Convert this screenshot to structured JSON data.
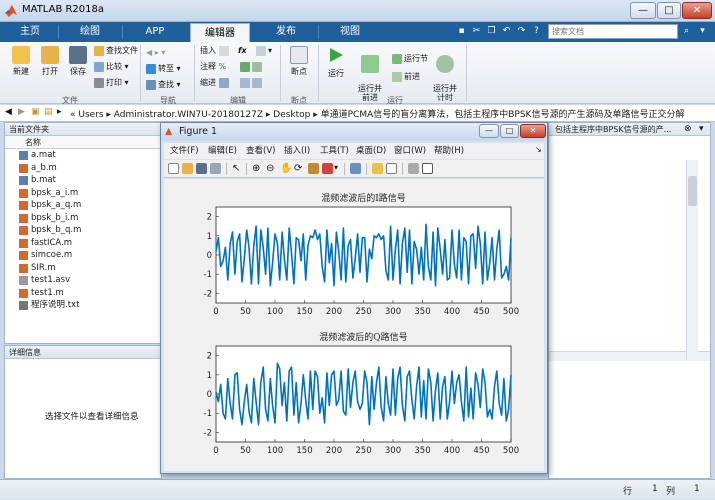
{
  "window": {
    "title": "MATLAB R2018a",
    "min": "—",
    "max": "□",
    "close": "✕"
  },
  "tabs": [
    "主页",
    "绘图",
    "APP",
    "编辑器",
    "发布",
    "视图"
  ],
  "search": {
    "placeholder": "搜索文档"
  },
  "toolstrip": {
    "file": {
      "new": "新建",
      "open": "打开",
      "save": "保存",
      "find_files": "查找文件",
      "compare": "比较",
      "print": "打印",
      "label": "文件"
    },
    "nav": {
      "goto": "转至",
      "find": "查找",
      "label": "导航"
    },
    "edit": {
      "insert": "插入",
      "comment": "注释",
      "indent": "缩进",
      "fx": "fx",
      "label": "编辑"
    },
    "breakpoint": {
      "bp": "断点",
      "label": "断点"
    },
    "run": {
      "run": "运行",
      "run_advance": "运行并\n前进",
      "run_section": "运行节",
      "advance": "前进",
      "run_time": "运行并\n计时",
      "label": "运行"
    }
  },
  "address": {
    "path": "« Users ▸ Administrator.WIN7U-20180127Z ▸ Desktop ▸ 单通道PCMA信号的盲分离算法，包括主程序中BPSK信号源的产生源码及单路信号正交分解"
  },
  "current_folder": {
    "title": "当前文件夹",
    "column": "名称",
    "files": [
      "a.mat",
      "a_b.m",
      "b.mat",
      "bpsk_a_i.m",
      "bpsk_a_q.m",
      "bpsk_b_i.m",
      "bpsk_b_q.m",
      "fastICA.m",
      "simcoe.m",
      "SIR.m",
      "test1.asv",
      "test1.m",
      "程序说明.txt"
    ]
  },
  "details": {
    "title": "详细信息",
    "message": "选择文件以查看详细信息"
  },
  "right_panel": {
    "title": "包括主程序中BPSK信号源的产..."
  },
  "status": {
    "row_label": "行",
    "row_value": "1",
    "col_label": "列",
    "col_value": "1"
  },
  "figure": {
    "title": "Figure 1",
    "menus": [
      "文件(F)",
      "编辑(E)",
      "查看(V)",
      "插入(I)",
      "工具(T)",
      "桌面(D)",
      "窗口(W)",
      "帮助(H)"
    ]
  },
  "chart_data": [
    {
      "type": "line",
      "title": "混频滤波后的I路信号",
      "xlim": [
        0,
        500
      ],
      "ylim": [
        -2.5,
        2.5
      ],
      "xticks": [
        0,
        50,
        100,
        150,
        200,
        250,
        300,
        350,
        400,
        450,
        500
      ],
      "yticks": [
        2,
        1,
        0,
        -1,
        -2
      ],
      "grid": false,
      "color": "#0072bd",
      "series": [
        {
          "x_step": 4,
          "values": [
            0.2,
            0.9,
            -0.6,
            -0.3,
            0.4,
            -1.3,
            0.6,
            1.2,
            -1.0,
            0.7,
            1.1,
            -1.4,
            -0.2,
            1.3,
            0.4,
            -1.5,
            0.5,
            1.5,
            -1.5,
            1.3,
            0.4,
            -1.0,
            1.4,
            -1.6,
            -0.4,
            1.1,
            0.6,
            -1.3,
            1.2,
            -0.2,
            -1.3,
            1.4,
            0.1,
            -1.5,
            0.9,
            0.8,
            -0.3,
            1.1,
            -1.3,
            0.5,
            1.0,
            0.9,
            1.3,
            0.8,
            1.1,
            -0.6,
            -1.4,
            1.3,
            -0.4,
            0.6,
            -1.6,
            1.2,
            0.2,
            -1.3,
            1.4,
            -1.4,
            0.5,
            0.8,
            -1.2,
            -0.2,
            1.1,
            -0.9,
            0.9,
            0.9,
            -1.4,
            0.3,
            -0.2,
            1.0,
            0.9,
            1.1,
            0.8,
            1.0,
            -0.8,
            -1.3,
            1.5,
            -1.3,
            0.3,
            1.3,
            -1.5,
            0.6,
            1.4,
            -0.9,
            1.3,
            -1.5,
            0.7,
            0.3,
            -1.0,
            0.4,
            -1.3,
            1.6,
            -0.6,
            -1.3,
            1.2,
            -1.6,
            1.4,
            0.3,
            -1.0,
            0.8,
            -1.3,
            -1.2,
            1.3,
            -0.5,
            -1.2,
            1.3,
            -1.3,
            0.9,
            0.7,
            -1.5,
            1.0,
            1.1,
            -0.7,
            1.5,
            0.6,
            -1.5,
            1.2,
            -1.3,
            -0.4,
            0.9,
            -1.3,
            0.3,
            1.3,
            -1.2,
            -1.0,
            -0.6,
            -1.3,
            0.9
          ]
        }
      ]
    },
    {
      "type": "line",
      "title": "混频滤波后的Q路信号",
      "xlim": [
        0,
        500
      ],
      "ylim": [
        -2.5,
        2.5
      ],
      "xticks": [
        0,
        50,
        100,
        150,
        200,
        250,
        300,
        350,
        400,
        450,
        500
      ],
      "yticks": [
        2,
        1,
        0,
        -1,
        -2
      ],
      "grid": false,
      "color": "#0072bd",
      "series": [
        {
          "x_step": 4,
          "values": [
            0.1,
            -0.4,
            0.5,
            -1.0,
            -1.3,
            0.8,
            -0.5,
            -1.3,
            1.0,
            1.1,
            -0.8,
            -1.6,
            -0.4,
            0.5,
            -0.9,
            -1.5,
            0.8,
            -0.4,
            -1.6,
            0.6,
            1.4,
            -0.8,
            -1.4,
            0.8,
            -0.6,
            -1.5,
            1.6,
            1.3,
            -0.6,
            0.6,
            -1.4,
            1.2,
            1.4,
            -1.1,
            0.6,
            -1.5,
            -0.5,
            1.0,
            -0.3,
            -1.3,
            1.2,
            -0.8,
            1.2,
            0.9,
            -1.0,
            -0.2,
            -1.5,
            1.1,
            -0.6,
            1.0,
            1.2,
            -0.6,
            -0.3,
            1.2,
            -0.9,
            -1.1,
            1.3,
            -0.7,
            0.6,
            1.2,
            -0.4,
            -0.8,
            -0.5,
            1.2,
            0.6,
            -1.6,
            0.9,
            -0.8,
            0.6,
            1.4,
            -0.7,
            -1.4,
            0.9,
            -0.5,
            -1.1,
            1.3,
            -1.1,
            0.8,
            1.4,
            -0.6,
            -1.4,
            0.9,
            1.2,
            -0.3,
            -1.3,
            0.4,
            1.4,
            -1.2,
            0.7,
            -1.3,
            1.3,
            0.6,
            -1.4,
            0.2,
            1.1,
            -1.3,
            0.4,
            0.9,
            -1.3,
            -0.4,
            1.2,
            -0.5,
            0.6,
            1.0,
            -0.4,
            -1.4,
            1.4,
            -1.2,
            0.3,
            -1.3,
            1.1,
            0.5,
            -0.7,
            1.3,
            0.6,
            -1.2,
            -0.8,
            -1.3,
            0.4,
            1.2,
            -0.5,
            -1.1,
            0.8,
            -1.4,
            -0.8,
            1.0
          ]
        }
      ]
    }
  ]
}
